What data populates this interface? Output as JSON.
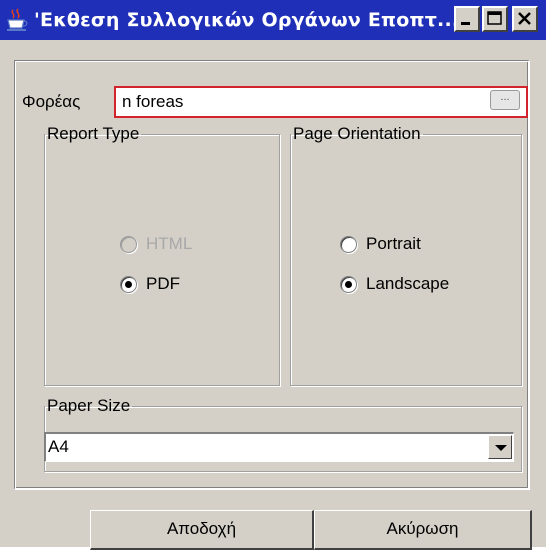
{
  "window": {
    "title": "'Εκθεση Συλλογικών Οργάνων Εποπτ...",
    "titlebar_color": "#1f2fb8",
    "background_color": "#d4d0c8",
    "controls": [
      "minimize-icon",
      "maximize-icon",
      "close-icon"
    ]
  },
  "foreas": {
    "label": "Φορέας",
    "value": "n foreas",
    "browse_label": "...",
    "highlight_color": "#d2232a"
  },
  "report_type": {
    "legend": "Report Type",
    "options": [
      {
        "label": "HTML",
        "selected": false,
        "enabled": false
      },
      {
        "label": "PDF",
        "selected": true,
        "enabled": true
      }
    ]
  },
  "page_orientation": {
    "legend": "Page Orientation",
    "options": [
      {
        "label": "Portrait",
        "selected": false
      },
      {
        "label": "Landscape",
        "selected": true
      }
    ]
  },
  "paper_size": {
    "legend": "Paper Size",
    "selected": "A4"
  },
  "buttons": {
    "ok": "Αποδοχή",
    "cancel": "Ακύρωση"
  }
}
